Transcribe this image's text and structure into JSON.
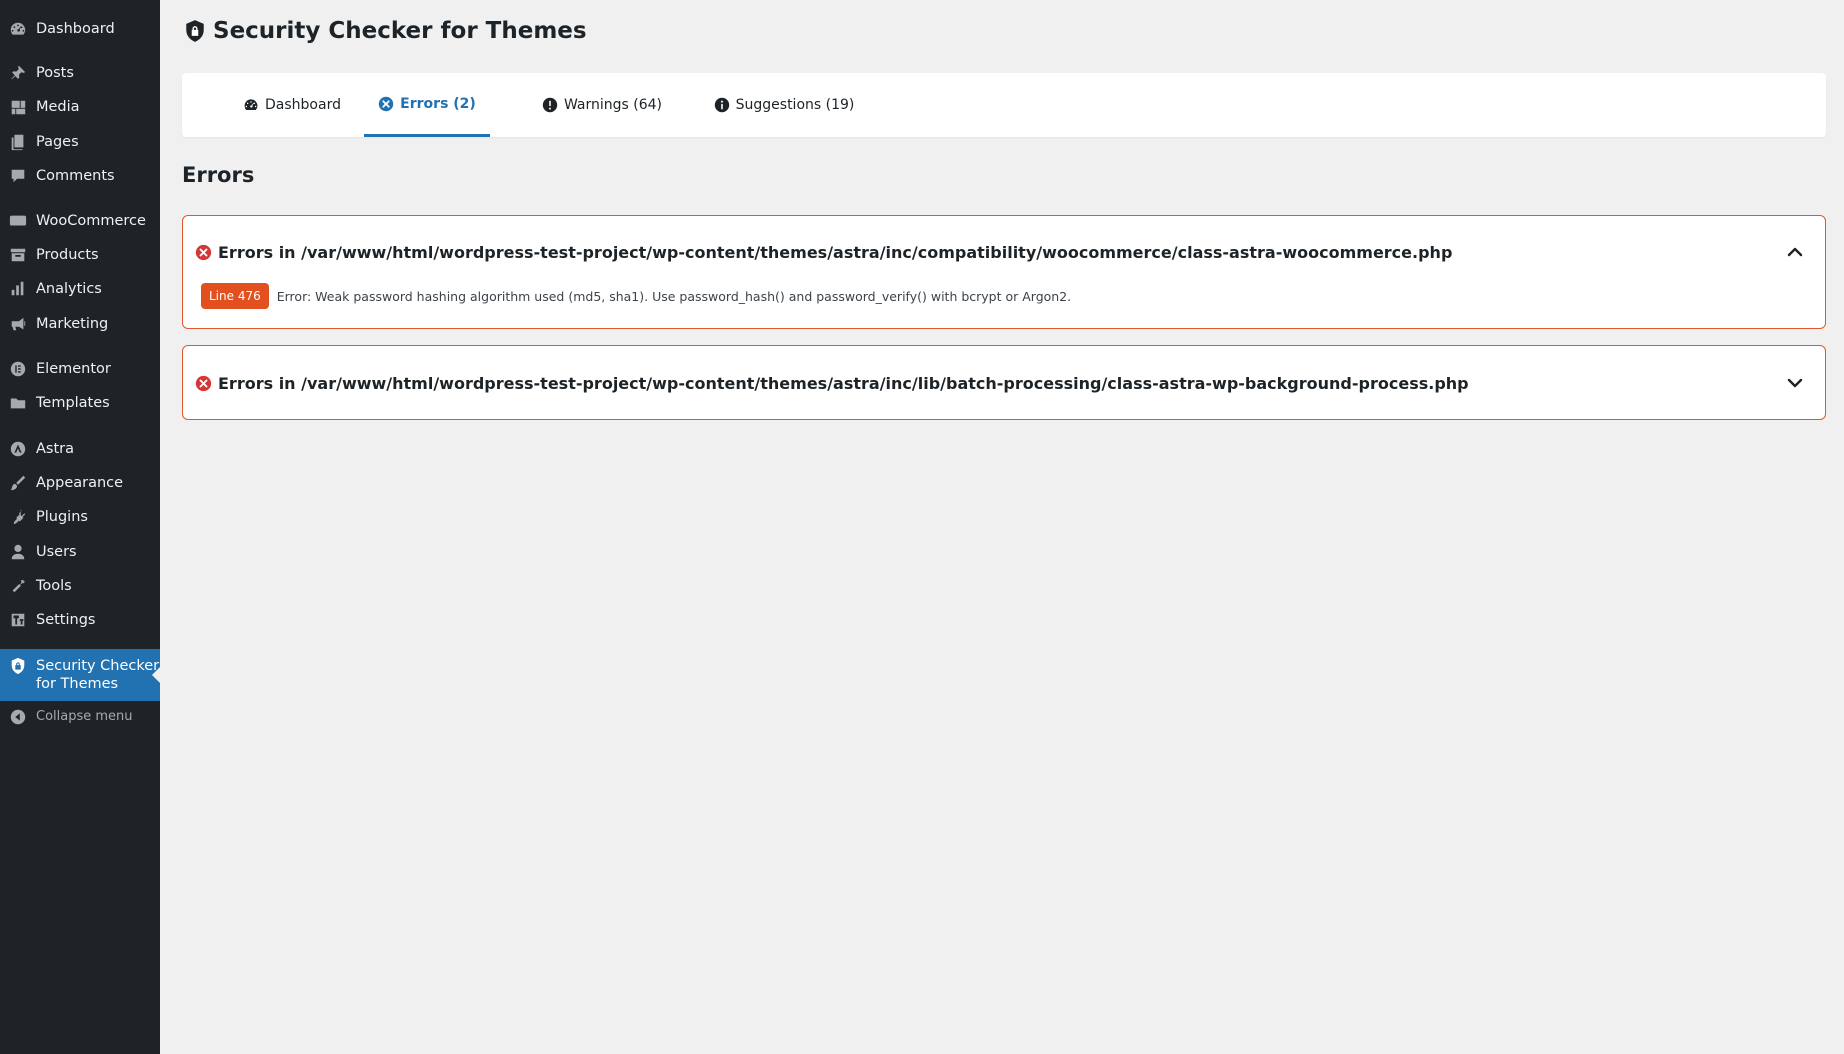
{
  "sidebar": {
    "items": [
      {
        "label": "Dashboard",
        "icon": "dashboard-icon"
      },
      {
        "label": "Posts",
        "icon": "pin-icon"
      },
      {
        "label": "Media",
        "icon": "media-icon"
      },
      {
        "label": "Pages",
        "icon": "pages-icon"
      },
      {
        "label": "Comments",
        "icon": "comment-icon"
      },
      {
        "label": "WooCommerce",
        "icon": "woo-icon"
      },
      {
        "label": "Products",
        "icon": "archive-icon"
      },
      {
        "label": "Analytics",
        "icon": "bar-chart-icon"
      },
      {
        "label": "Marketing",
        "icon": "megaphone-icon"
      },
      {
        "label": "Elementor",
        "icon": "elementor-icon"
      },
      {
        "label": "Templates",
        "icon": "folder-icon"
      },
      {
        "label": "Astra",
        "icon": "astra-icon"
      },
      {
        "label": "Appearance",
        "icon": "brush-icon"
      },
      {
        "label": "Plugins",
        "icon": "plug-icon"
      },
      {
        "label": "Users",
        "icon": "user-icon"
      },
      {
        "label": "Tools",
        "icon": "wrench-icon"
      },
      {
        "label": "Settings",
        "icon": "settings-icon"
      }
    ],
    "active_item": {
      "label_line1": "Security Checker",
      "label_line2": "for Themes",
      "icon": "shield-icon"
    },
    "collapse": {
      "label": "Collapse menu",
      "icon": "collapse-icon"
    }
  },
  "page": {
    "title": "Security Checker for Themes",
    "title_icon": "shield-lock-icon"
  },
  "tabs": [
    {
      "label": "Dashboard",
      "icon": "gauge-icon",
      "active": false
    },
    {
      "label": "Errors (2)",
      "icon": "error-circle-icon",
      "active": true
    },
    {
      "label": "Warnings (64)",
      "icon": "warning-circle-icon",
      "active": false
    },
    {
      "label": "Suggestions (19)",
      "icon": "info-circle-icon",
      "active": false
    }
  ],
  "section": {
    "title": "Errors"
  },
  "errors": [
    {
      "title": "Errors in /var/www/html/wordpress-test-project/wp-content/themes/astra/inc/compatibility/woocommerce/class-astra-woocommerce.php",
      "expanded": true,
      "line_badge": "Line 476",
      "message": "Error: Weak password hashing algorithm used (md5, sha1). Use password_hash() and password_verify() with bcrypt or Argon2."
    },
    {
      "title": "Errors in /var/www/html/wordpress-test-project/wp-content/themes/astra/inc/lib/batch-processing/class-astra-wp-background-process.php",
      "expanded": false
    }
  ],
  "colors": {
    "sidebar_bg": "#1d2327",
    "accent": "#2271b1",
    "error": "#e2501f",
    "page_bg": "#f0f0f1"
  }
}
